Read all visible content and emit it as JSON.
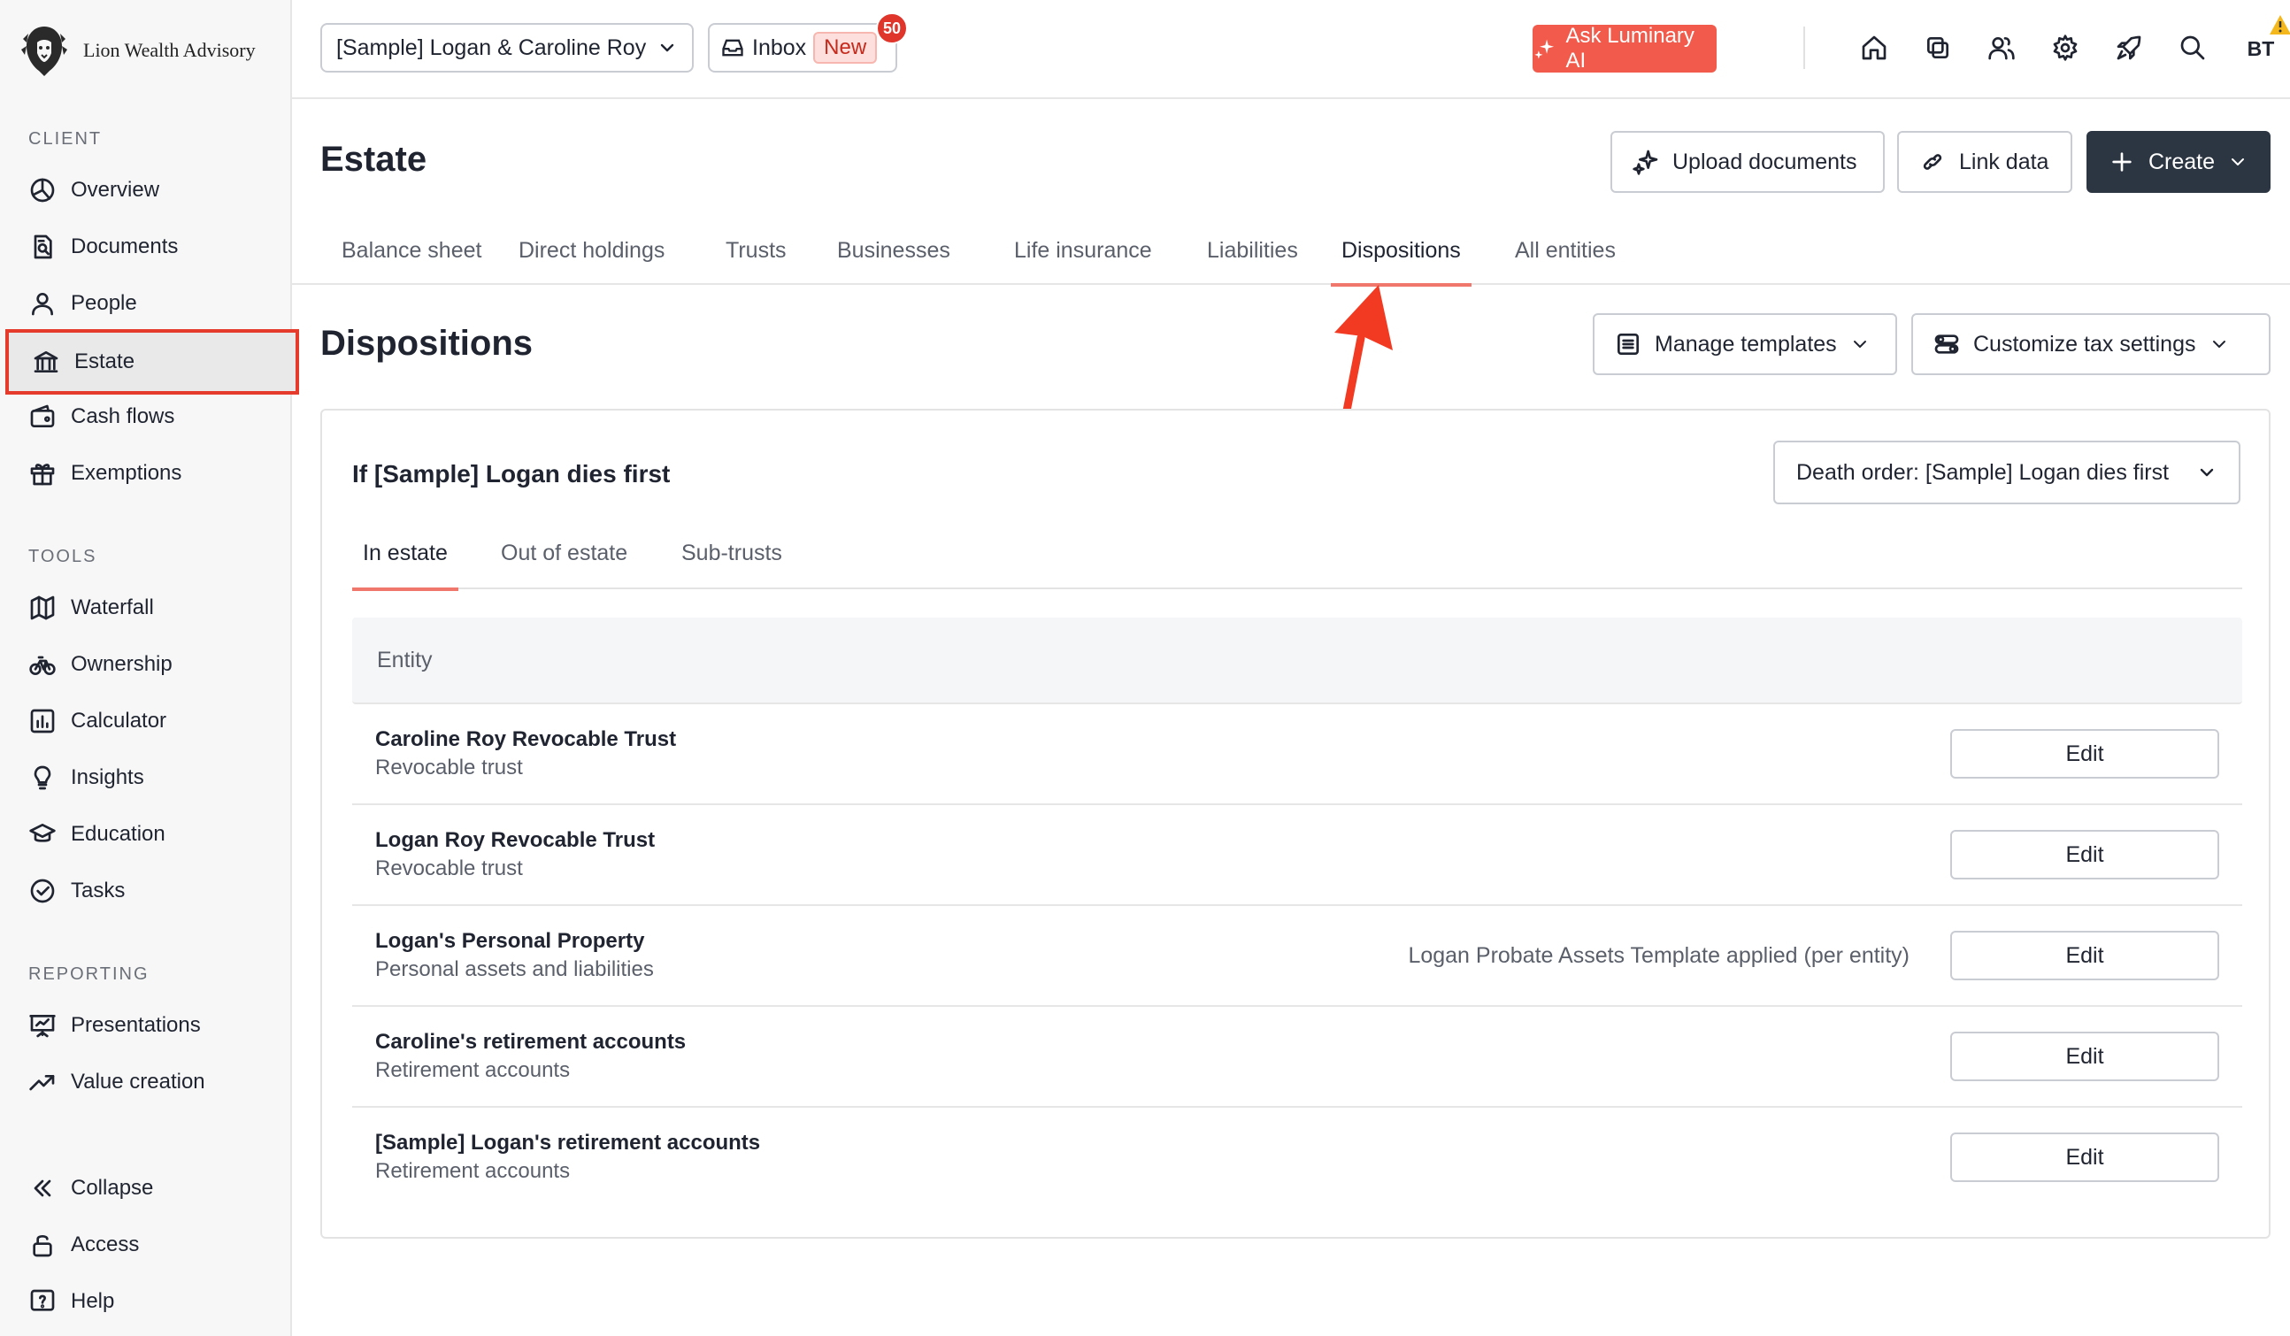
{
  "brand": {
    "name": "Lion Wealth Advisory"
  },
  "sidebar": {
    "sections": {
      "client": "CLIENT",
      "tools": "TOOLS",
      "reporting": "REPORTING"
    },
    "client_items": [
      {
        "label": "Overview",
        "icon": "chart-pie-icon"
      },
      {
        "label": "Documents",
        "icon": "document-search-icon"
      },
      {
        "label": "People",
        "icon": "person-icon"
      },
      {
        "label": "Estate",
        "icon": "bank-icon",
        "active": true
      },
      {
        "label": "Cash flows",
        "icon": "wallet-icon"
      },
      {
        "label": "Exemptions",
        "icon": "gift-icon"
      }
    ],
    "tools_items": [
      {
        "label": "Waterfall",
        "icon": "map-icon"
      },
      {
        "label": "Ownership",
        "icon": "bicycle-icon"
      },
      {
        "label": "Calculator",
        "icon": "bar-chart-icon"
      },
      {
        "label": "Insights",
        "icon": "lightbulb-icon"
      },
      {
        "label": "Education",
        "icon": "graduation-cap-icon"
      },
      {
        "label": "Tasks",
        "icon": "check-circle-icon"
      }
    ],
    "reporting_items": [
      {
        "label": "Presentations",
        "icon": "presentation-icon"
      },
      {
        "label": "Value creation",
        "icon": "trending-up-icon"
      }
    ],
    "bottom_items": [
      {
        "label": "Collapse",
        "icon": "chevrons-left-icon"
      },
      {
        "label": "Access",
        "icon": "lock-icon"
      },
      {
        "label": "Help",
        "icon": "help-icon"
      }
    ]
  },
  "topbar": {
    "client_selector": "[Sample] Logan & Caroline Roy",
    "inbox_label": "Inbox",
    "inbox_badge": "New",
    "inbox_count": "50",
    "ai_button": "Ask Luminary AI",
    "avatar_initials": "BT",
    "icons": [
      "home-icon",
      "copy-icon",
      "users-icon",
      "gear-icon",
      "rocket-icon",
      "search-icon"
    ]
  },
  "page": {
    "title": "Estate",
    "upload_button": "Upload documents",
    "link_button": "Link data",
    "create_button": "Create",
    "tabs": [
      "Balance sheet",
      "Direct holdings",
      "Trusts",
      "Businesses",
      "Life insurance",
      "Liabilities",
      "Dispositions",
      "All entities"
    ],
    "active_tab": "Dispositions"
  },
  "dispositions": {
    "title": "Dispositions",
    "manage_templates": "Manage templates",
    "customize_tax": "Customize tax settings",
    "card_title": "If [Sample] Logan dies first",
    "death_order": "Death order: [Sample] Logan dies first",
    "sub_tabs": [
      "In estate",
      "Out of estate",
      "Sub-trusts"
    ],
    "active_sub_tab": "In estate",
    "table_header": "Entity",
    "edit_label": "Edit",
    "rows": [
      {
        "name": "Caroline Roy Revocable Trust",
        "type": "Revocable trust",
        "note": ""
      },
      {
        "name": "Logan Roy Revocable Trust",
        "type": "Revocable trust",
        "note": ""
      },
      {
        "name": "Logan's Personal Property",
        "type": "Personal assets and liabilities",
        "note": "Logan Probate Assets Template applied (per entity)"
      },
      {
        "name": "Caroline's retirement accounts",
        "type": "Retirement accounts",
        "note": ""
      },
      {
        "name": "[Sample] Logan's retirement accounts",
        "type": "Retirement accounts",
        "note": ""
      }
    ]
  },
  "colors": {
    "accent": "#f25a4b",
    "highlight_border": "#e53b2c",
    "create_button": "#2c3542",
    "tab_underline": "#f0776b"
  }
}
